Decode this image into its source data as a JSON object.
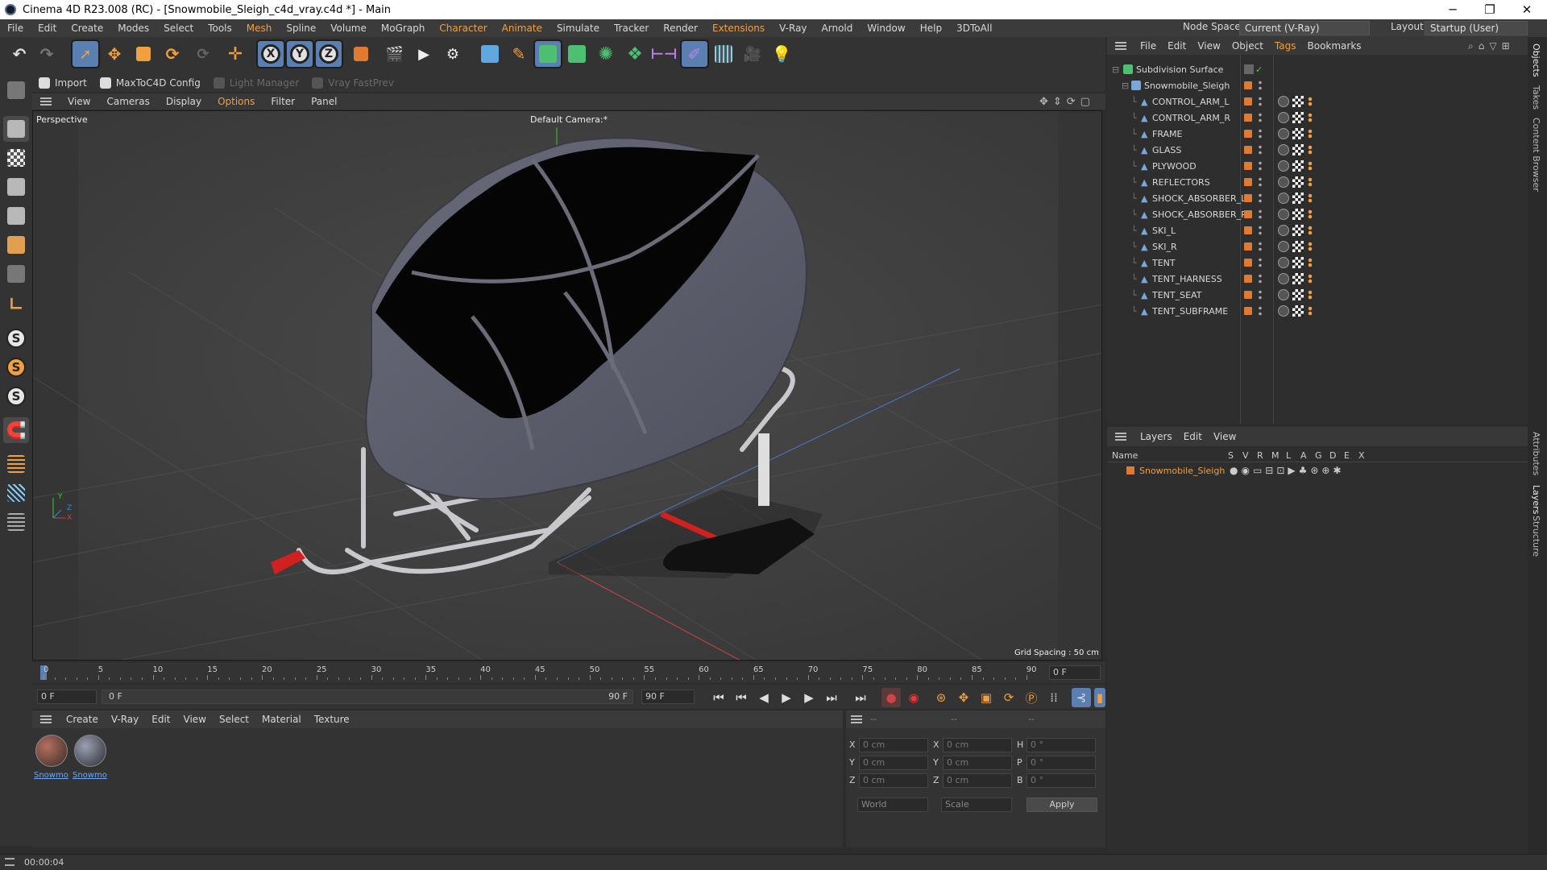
{
  "window": {
    "title": "Cinema 4D R23.008 (RC) - [Snowmobile_Sleigh_c4d_vray.c4d *] - Main",
    "controls": {
      "minimize": "─",
      "restore": "❐",
      "close": "✕"
    }
  },
  "menubar": {
    "items": [
      "File",
      "Edit",
      "Create",
      "Modes",
      "Select",
      "Tools",
      "Mesh",
      "Spline",
      "Volume",
      "MoGraph",
      "Character",
      "Animate",
      "Simulate",
      "Tracker",
      "Render",
      "Extensions",
      "V-Ray",
      "Arnold",
      "Window",
      "Help",
      "3DToAll"
    ],
    "node_space_label": "Node Space:",
    "node_space_value": "Current (V-Ray)",
    "layout_label": "Layout:",
    "layout_value": "Startup (User)"
  },
  "toolbar": {
    "x_label": "X",
    "y_label": "Y",
    "z_label": "Z"
  },
  "plugbar": {
    "items": [
      {
        "label": "Import",
        "enabled": true
      },
      {
        "label": "MaxToC4D Config",
        "enabled": true
      },
      {
        "label": "Light Manager",
        "enabled": false
      },
      {
        "label": "Vray FastPrev",
        "enabled": false
      }
    ]
  },
  "left_tools": {
    "s_labels": [
      "S",
      "S",
      "S"
    ]
  },
  "viewport": {
    "menu": [
      "View",
      "Cameras",
      "Display",
      "Options",
      "Filter",
      "Panel"
    ],
    "projection_label": "Perspective",
    "camera_label": "Default Camera",
    "camera_suffix": ":*",
    "grid_spacing": "Grid Spacing : 50 cm",
    "axis_x": "X",
    "axis_y": "Y",
    "axis_z": "Z"
  },
  "timeline": {
    "ticks": [
      "0",
      "5",
      "10",
      "15",
      "20",
      "25",
      "30",
      "35",
      "40",
      "45",
      "50",
      "55",
      "60",
      "65",
      "70",
      "75",
      "80",
      "85",
      "90"
    ],
    "current_frame_field": "0 F"
  },
  "playback": {
    "start_field": "0 F",
    "range_start": "0 F",
    "range_end": "90 F",
    "end_field": "90 F"
  },
  "material_manager": {
    "menu": [
      "Create",
      "V-Ray",
      "Edit",
      "View",
      "Select",
      "Material",
      "Texture"
    ],
    "materials": [
      {
        "label": "Snowmo"
      },
      {
        "label": "Snowmo"
      }
    ]
  },
  "coordinates": {
    "header": [
      "--",
      "--",
      "--"
    ],
    "rows": [
      {
        "a_label": "X",
        "a_value": "0 cm",
        "b_label": "X",
        "b_value": "0 cm",
        "c_label": "H",
        "c_value": "0 °"
      },
      {
        "a_label": "Y",
        "a_value": "0 cm",
        "b_label": "Y",
        "b_value": "0 cm",
        "c_label": "P",
        "c_value": "0 °"
      },
      {
        "a_label": "Z",
        "a_value": "0 cm",
        "b_label": "Z",
        "b_value": "0 cm",
        "c_label": "B",
        "c_value": "0 °"
      }
    ],
    "space_select": "World",
    "mode_select": "Scale",
    "apply_label": "Apply"
  },
  "object_manager": {
    "menu": [
      "File",
      "Edit",
      "View",
      "Object",
      "Tags",
      "Bookmarks"
    ],
    "root": "Subdivision Surface",
    "group": "Snowmobile_Sleigh",
    "children": [
      "CONTROL_ARM_L",
      "CONTROL_ARM_R",
      "FRAME",
      "GLASS",
      "PLYWOOD",
      "REFLECTORS",
      "SHOCK_ABSORBER_L",
      "SHOCK_ABSORBER_R",
      "SKI_L",
      "SKI_R",
      "TENT",
      "TENT_HARNESS",
      "TENT_SEAT",
      "TENT_SUBFRAME"
    ]
  },
  "layer_manager": {
    "menu": [
      "Layers",
      "Edit",
      "View"
    ],
    "columns": [
      "Name",
      "S",
      "V",
      "R",
      "M",
      "L",
      "A",
      "G",
      "D",
      "E",
      "X"
    ],
    "layers": [
      {
        "name": "Snowmobile_Sleigh",
        "color": "#e07a30"
      }
    ]
  },
  "right_tabs": [
    "Objects",
    "Takes",
    "Content Browser",
    "Attributes",
    "Layers",
    "Structure"
  ],
  "status": {
    "time": "00:00:04"
  },
  "colors": {
    "accent": "#f0a040",
    "layer_orange": "#e07a30",
    "selection_blue": "#5b7fb0"
  }
}
